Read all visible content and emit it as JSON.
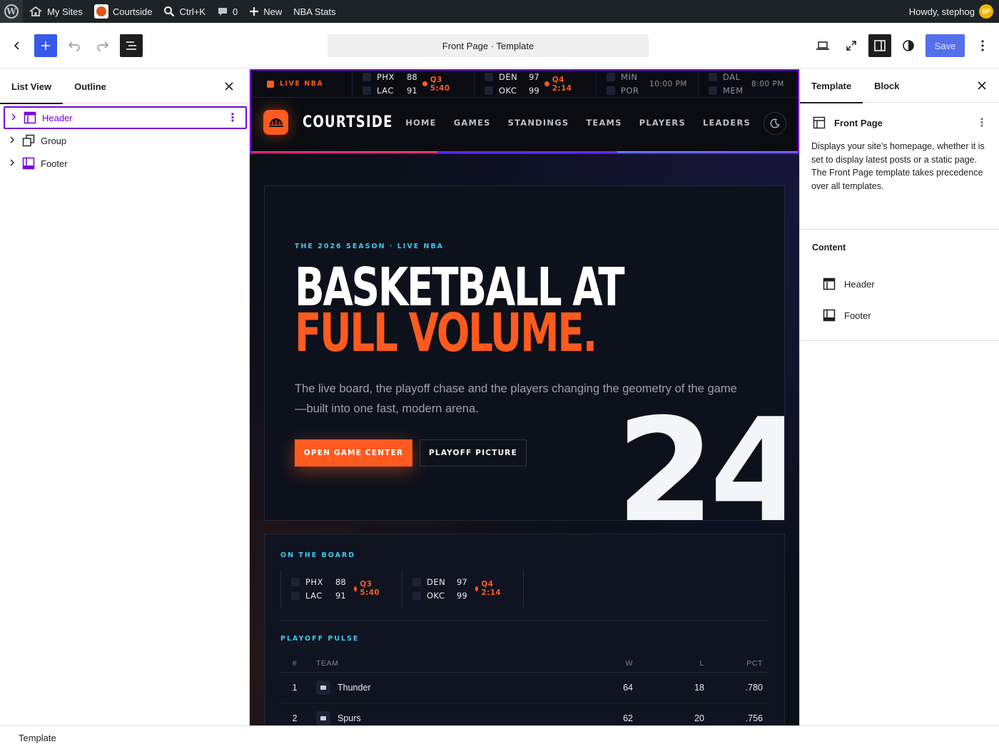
{
  "admin_bar": {
    "my_sites": "My Sites",
    "site_name": "Courtside",
    "search_shortcut": "Ctrl+K",
    "comments_count": "0",
    "new_label": "New",
    "nba_stats": "NBA Stats",
    "howdy": "Howdy, stephog",
    "avatar_initials": "SP"
  },
  "toolbar": {
    "document_title": "Front Page · Template",
    "save_label": "Save"
  },
  "list_view": {
    "tabs": [
      "List View",
      "Outline"
    ],
    "items": [
      {
        "label": "Header",
        "selected": true
      },
      {
        "label": "Group",
        "selected": false
      },
      {
        "label": "Footer",
        "selected": false
      }
    ]
  },
  "sidebar": {
    "tabs": [
      "Template",
      "Block"
    ],
    "template_title": "Front Page",
    "template_description": "Displays your site's homepage, whether it is set to display latest posts or a static page. The Front Page template takes precedence over all templates.",
    "content_heading": "Content",
    "content_items": [
      "Header",
      "Footer"
    ]
  },
  "status_bar": {
    "label": "Template"
  },
  "site": {
    "ticker": {
      "live_label": "LIVE NBA",
      "games": [
        {
          "away": "PHX",
          "away_score": "88",
          "home": "LAC",
          "home_score": "91",
          "status": "Q3 5:40",
          "live": true
        },
        {
          "away": "DEN",
          "away_score": "97",
          "home": "OKC",
          "home_score": "99",
          "status": "Q4 2:14",
          "live": true
        },
        {
          "away": "MIN",
          "away_score": "",
          "home": "POR",
          "home_score": "",
          "status": "10:00 PM",
          "live": false
        },
        {
          "away": "DAL",
          "away_score": "",
          "home": "MEM",
          "home_score": "",
          "status": "8:00 PM",
          "live": false
        }
      ]
    },
    "brand_name": "COURTSIDE",
    "nav": [
      "HOME",
      "GAMES",
      "STANDINGS",
      "TEAMS",
      "PLAYERS",
      "LEADERS"
    ],
    "hero": {
      "kicker": "THE 2026 SEASON · LIVE NBA",
      "headline_line1": "BASKETBALL AT",
      "headline_line2": "FULL VOLUME.",
      "lede": "The live board, the playoff chase and the players changing the geometry of the game—built into one fast, modern arena.",
      "primary_cta": "OPEN GAME CENTER",
      "secondary_cta": "PLAYOFF PICTURE",
      "big_number": "24"
    },
    "board": {
      "label": "ON THE BOARD",
      "games": [
        {
          "away": "PHX",
          "away_score": "88",
          "home": "LAC",
          "home_score": "91",
          "status": "Q3 5:40"
        },
        {
          "away": "DEN",
          "away_score": "97",
          "home": "OKC",
          "home_score": "99",
          "status": "Q4 2:14"
        }
      ]
    },
    "playoff": {
      "label": "PLAYOFF PULSE",
      "columns": {
        "rank": "#",
        "team": "TEAM",
        "w": "W",
        "l": "L",
        "pct": "PCT"
      },
      "rows": [
        {
          "rank": "1",
          "team": "Thunder",
          "w": "64",
          "l": "18",
          "pct": ".780"
        },
        {
          "rank": "2",
          "team": "Spurs",
          "w": "62",
          "l": "20",
          "pct": ".756"
        }
      ]
    }
  },
  "colors": {
    "accent": "#ff5a1f",
    "wp_blue": "#3858e9",
    "selection": "#7a00df",
    "cyan": "#3ec8f0"
  }
}
